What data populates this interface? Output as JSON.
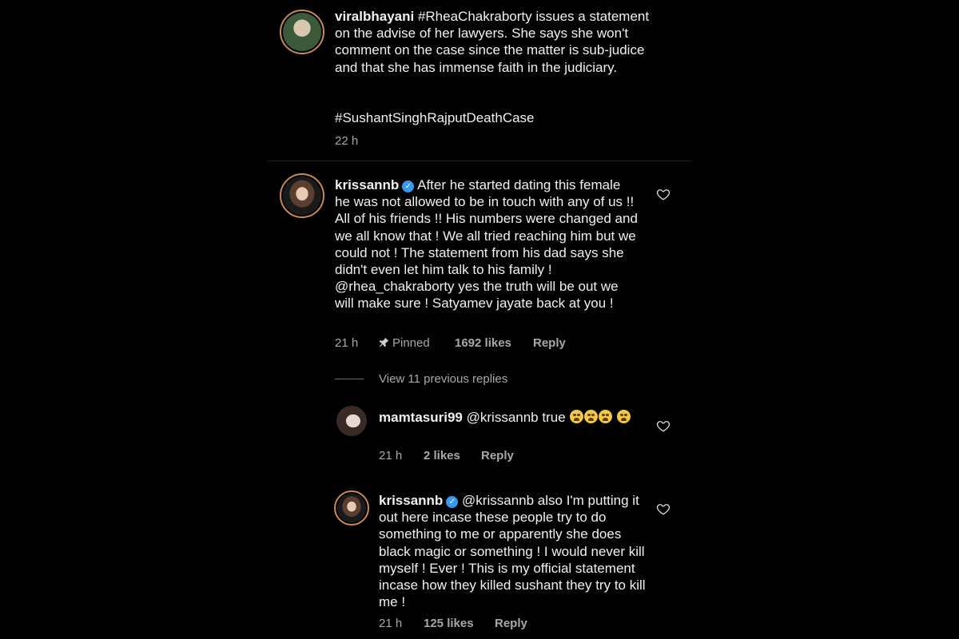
{
  "post": {
    "username": "viralbhayani",
    "caption": "#RheaChakraborty issues a statement on the advise of her lawyers. She says she won't comment on the case since the matter is sub-judice and that she has immense faith in the judiciary.",
    "hashtag": "#SushantSinghRajputDeathCase",
    "time": "22 h"
  },
  "comment": {
    "username": "krissannb",
    "text": "After he started dating this female he was not allowed to be in touch with any of us !! All of his friends !! His numbers were changed and we all know that ! We all tried reaching him but we could not ! The statement from his dad says she didn't even let him talk to his family ! @rhea_chakraborty yes the truth will be out we will make sure ! Satyamev jayate back at you !",
    "time": "21 h",
    "pinned": "Pinned",
    "likes": "1692 likes",
    "reply": "Reply",
    "view_replies": "View 11 previous replies"
  },
  "replies": [
    {
      "username": "mamtasuri99",
      "text": "@krissannb true",
      "time": "21 h",
      "likes": "2 likes",
      "reply": "Reply"
    },
    {
      "username": "krissannb",
      "text": "@krissannb also I'm putting it out here incase these people try to do something to me or apparently she does black magic or something ! I would never kill myself ! Ever ! This is my official statement incase how they killed sushant they try to kill me !",
      "time": "21 h",
      "likes": "125 likes",
      "reply": "Reply"
    }
  ],
  "icons": {
    "heart": "heart-outline-icon",
    "pin": "pin-icon",
    "verified": "verified-badge-icon",
    "emoji": "loudly-crying-face-emoji"
  },
  "colors": {
    "background": "#000000",
    "text": "#f0f0f0",
    "meta": "#a8a8a8",
    "verified": "#3897f0",
    "story_ring": "#c9885a"
  }
}
